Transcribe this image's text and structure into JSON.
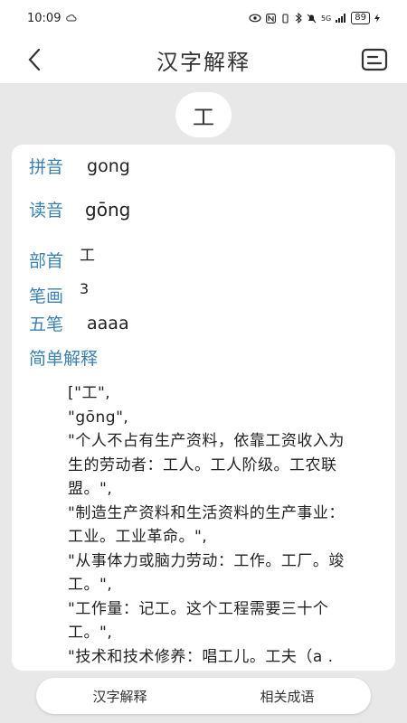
{
  "status": {
    "time": "10:09",
    "signal": "5G",
    "battery": "89"
  },
  "header": {
    "title": "汉字解释"
  },
  "character": "工",
  "details": {
    "pinyin_label": "拼音",
    "pinyin_value": "gong",
    "reading_label": "读音",
    "reading_value": "gōng",
    "radical_label": "部首",
    "radical_value": "工",
    "strokes_label": "笔画",
    "strokes_value": "3",
    "wubi_label": "五笔",
    "wubi_value": "aaaa",
    "explain_label": "简单解释"
  },
  "explanation_lines": [
    "[\"工\",",
    "\"gōng\",",
    "\"个人不占有生产资料，依靠工资收入为",
    "生的劳动者：工人。工人阶级。工农联",
    "盟。\",",
    "\"制造生产资料和生活资料的生产事业：",
    "工业。工业革命。\",",
    "\"从事体力或脑力劳动：工作。工厂。竣",
    "工。\",",
    "\"工作量：记工。这个工程需要三十个",
    "工。\",",
    "\"技术和技术修养：唱工儿。工夫（a ."
  ],
  "tabs": {
    "tab1": "汉字解释",
    "tab2": "相关成语"
  }
}
